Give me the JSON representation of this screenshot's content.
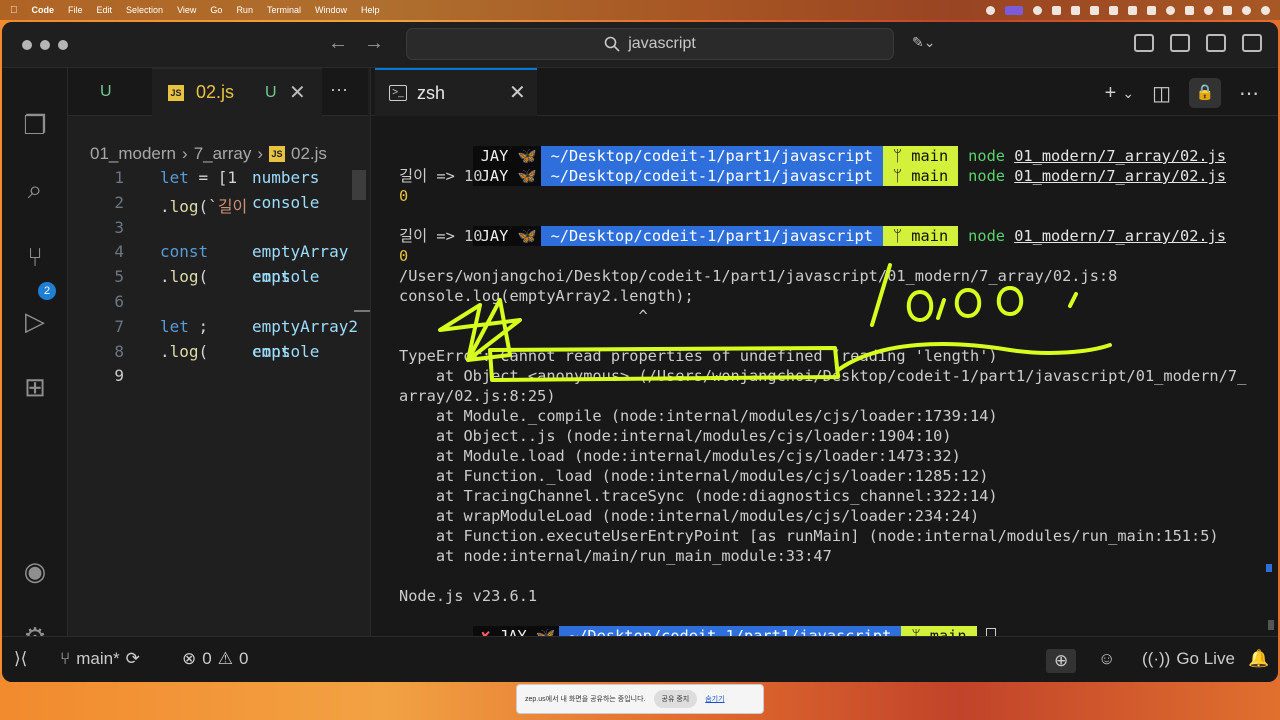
{
  "menubar": {
    "app": "Code",
    "items": [
      "File",
      "Edit",
      "Selection",
      "View",
      "Go",
      "Run",
      "Terminal",
      "Window",
      "Help"
    ]
  },
  "titlebar": {
    "search": "javascript",
    "back": "←",
    "forward": "→"
  },
  "sidebar": {
    "scm_badge": "2"
  },
  "editor": {
    "tab_prev_status": "U",
    "tab_name": "02.js",
    "tab_status": "U",
    "breadcrumb": [
      "01_modern",
      "7_array",
      "02.js"
    ],
    "lines": [
      {
        "n": "1",
        "parts": [
          [
            "kw",
            "let "
          ],
          [
            "src",
            "numbers"
          ],
          [
            "pl",
            " = [1"
          ]
        ]
      },
      {
        "n": "2",
        "parts": [
          [
            "src",
            "console"
          ],
          [
            "pl",
            "."
          ],
          [
            "fn",
            "log"
          ],
          [
            "pl",
            "(`"
          ],
          [
            "st",
            "길이"
          ]
        ]
      },
      {
        "n": "3",
        "parts": []
      },
      {
        "n": "4",
        "parts": [
          [
            "kw",
            "const "
          ],
          [
            "src",
            "emptyArray"
          ]
        ]
      },
      {
        "n": "5",
        "parts": [
          [
            "src",
            "console"
          ],
          [
            "pl",
            "."
          ],
          [
            "fn",
            "log"
          ],
          [
            "pl",
            "("
          ],
          [
            "src",
            "empt"
          ]
        ]
      },
      {
        "n": "6",
        "parts": []
      },
      {
        "n": "7",
        "parts": [
          [
            "kw",
            "let "
          ],
          [
            "src",
            "emptyArray2"
          ],
          [
            "pl",
            ";"
          ]
        ]
      },
      {
        "n": "8",
        "parts": [
          [
            "src",
            "console"
          ],
          [
            "pl",
            "."
          ],
          [
            "fn",
            "log"
          ],
          [
            "pl",
            "("
          ],
          [
            "src",
            "empt"
          ]
        ]
      },
      {
        "n": "9",
        "parts": []
      }
    ]
  },
  "terminal": {
    "tab_name": "zsh",
    "prompt_user": "JAY 🦋",
    "prompt_path": "~/Desktop/codeit-1/part1/javascript",
    "prompt_branch": "ᛘ main",
    "cmd": "node",
    "cmd_arg": "01_modern/7_array/02.js",
    "output": [
      "길이 => 10",
      "0",
      "길이 => 10",
      "0",
      "/Users/wonjangchoi/Desktop/codeit-1/part1/javascript/01_modern/7_array/02.js:8",
      "console.log(emptyArray2.length);",
      "                          ^",
      "",
      "TypeError: Cannot read properties of undefined (reading 'length')",
      "    at Object.<anonymous> (/Users/wonjangchoi/Desktop/codeit-1/part1/javascript/01_modern/7_",
      "array/02.js:8:25)",
      "    at Module._compile (node:internal/modules/cjs/loader:1739:14)",
      "    at Object..js (node:internal/modules/cjs/loader:1904:10)",
      "    at Module.load (node:internal/modules/cjs/loader:1473:32)",
      "    at Function._load (node:internal/modules/cjs/loader:1285:12)",
      "    at TracingChannel.traceSync (node:diagnostics_channel:322:14)",
      "    at wrapModuleLoad (node:internal/modules/cjs/loader:234:24)",
      "    at Function.executeUserEntryPoint [as runMain] (node:internal/modules/run_main:151:5)",
      "    at node:internal/main/run_main_module:33:47",
      "",
      "Node.js v23.6.1"
    ],
    "final_prompt_mark": "✘"
  },
  "statusbar": {
    "branch": "main*",
    "errors": "0",
    "warnings": "0",
    "golive": "Go Live"
  },
  "share_bar": {
    "text": "zep.us에서 내 화면을 공유하는 중입니다.",
    "stop": "공유 중지",
    "hide": "숨기기"
  },
  "annotation": {
    "handwriting": "10,000"
  },
  "colors": {
    "accent": "#0078d4",
    "prompt_path_bg": "#2f6fdc",
    "prompt_git_bg": "#d3f03a",
    "annotation": "#d7ff1e"
  }
}
